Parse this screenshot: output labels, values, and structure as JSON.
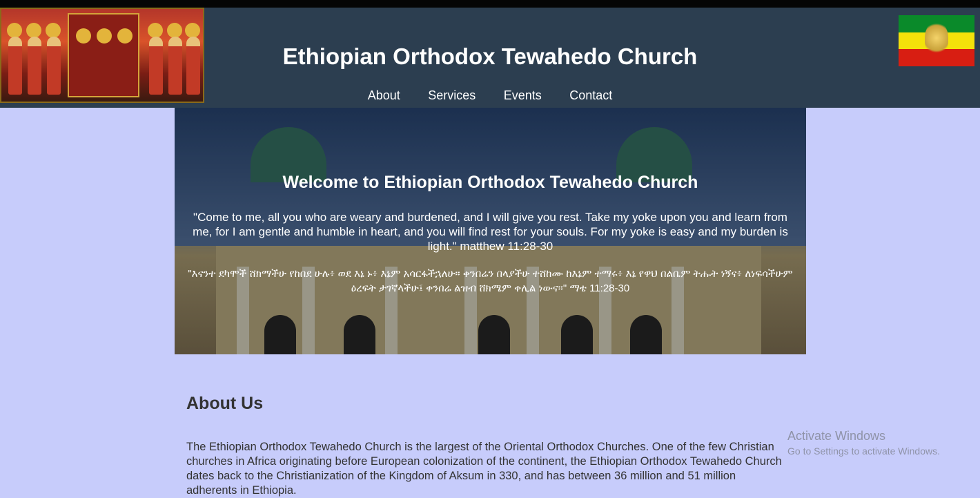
{
  "header": {
    "title": "Ethiopian Orthodox Tewahedo Church",
    "nav": [
      "About",
      "Services",
      "Events",
      "Contact"
    ],
    "logo_icon": "icon-painting",
    "flag_icon": "ethiopian-flag"
  },
  "hero": {
    "heading": "Welcome to Ethiopian Orthodox Tewahedo Church",
    "verse_en": "\"Come to me, all you who are weary and burdened, and I will give you rest. Take my yoke upon you and learn from me, for I am gentle and humble in heart, and you will find rest for your souls. For my yoke is easy and my burden is light.\" matthew 11:28-30",
    "verse_am": "\"እናንተ ደካሞች ሸክማችሁ የከበደ ሁሉ፥ ወደ እኔ ኑ፥ እኔም አሳርፋችኋለሁ። ቀንበሬን በላያችሁ ተሸከሙ ከእኔም ተማሩ፥ እኔ የዋህ በልቤም ትሑት ነኝና፥ ለነፍሳችሁም ዕረፍት ታገኛላችሁ፤ ቀንበሬ ልዝብ ሸክሜም ቀሊል ነውና።\" ማቴ 11:28-30"
  },
  "about": {
    "heading": "About Us",
    "text": "The Ethiopian Orthodox Tewahedo Church is the largest of the Oriental Orthodox Churches. One of the few Christian churches in Africa originating before European colonization of the continent, the Ethiopian Orthodox Tewahedo Church dates back to the Christianization of the Kingdom of Aksum in 330, and has between 36 million and 51 million adherents in Ethiopia."
  },
  "watermark": {
    "line1": "Activate Windows",
    "line2": "Go to Settings to activate Windows."
  },
  "colors": {
    "header_bg": "#2c3e50",
    "page_bg": "#c7ccfb"
  }
}
